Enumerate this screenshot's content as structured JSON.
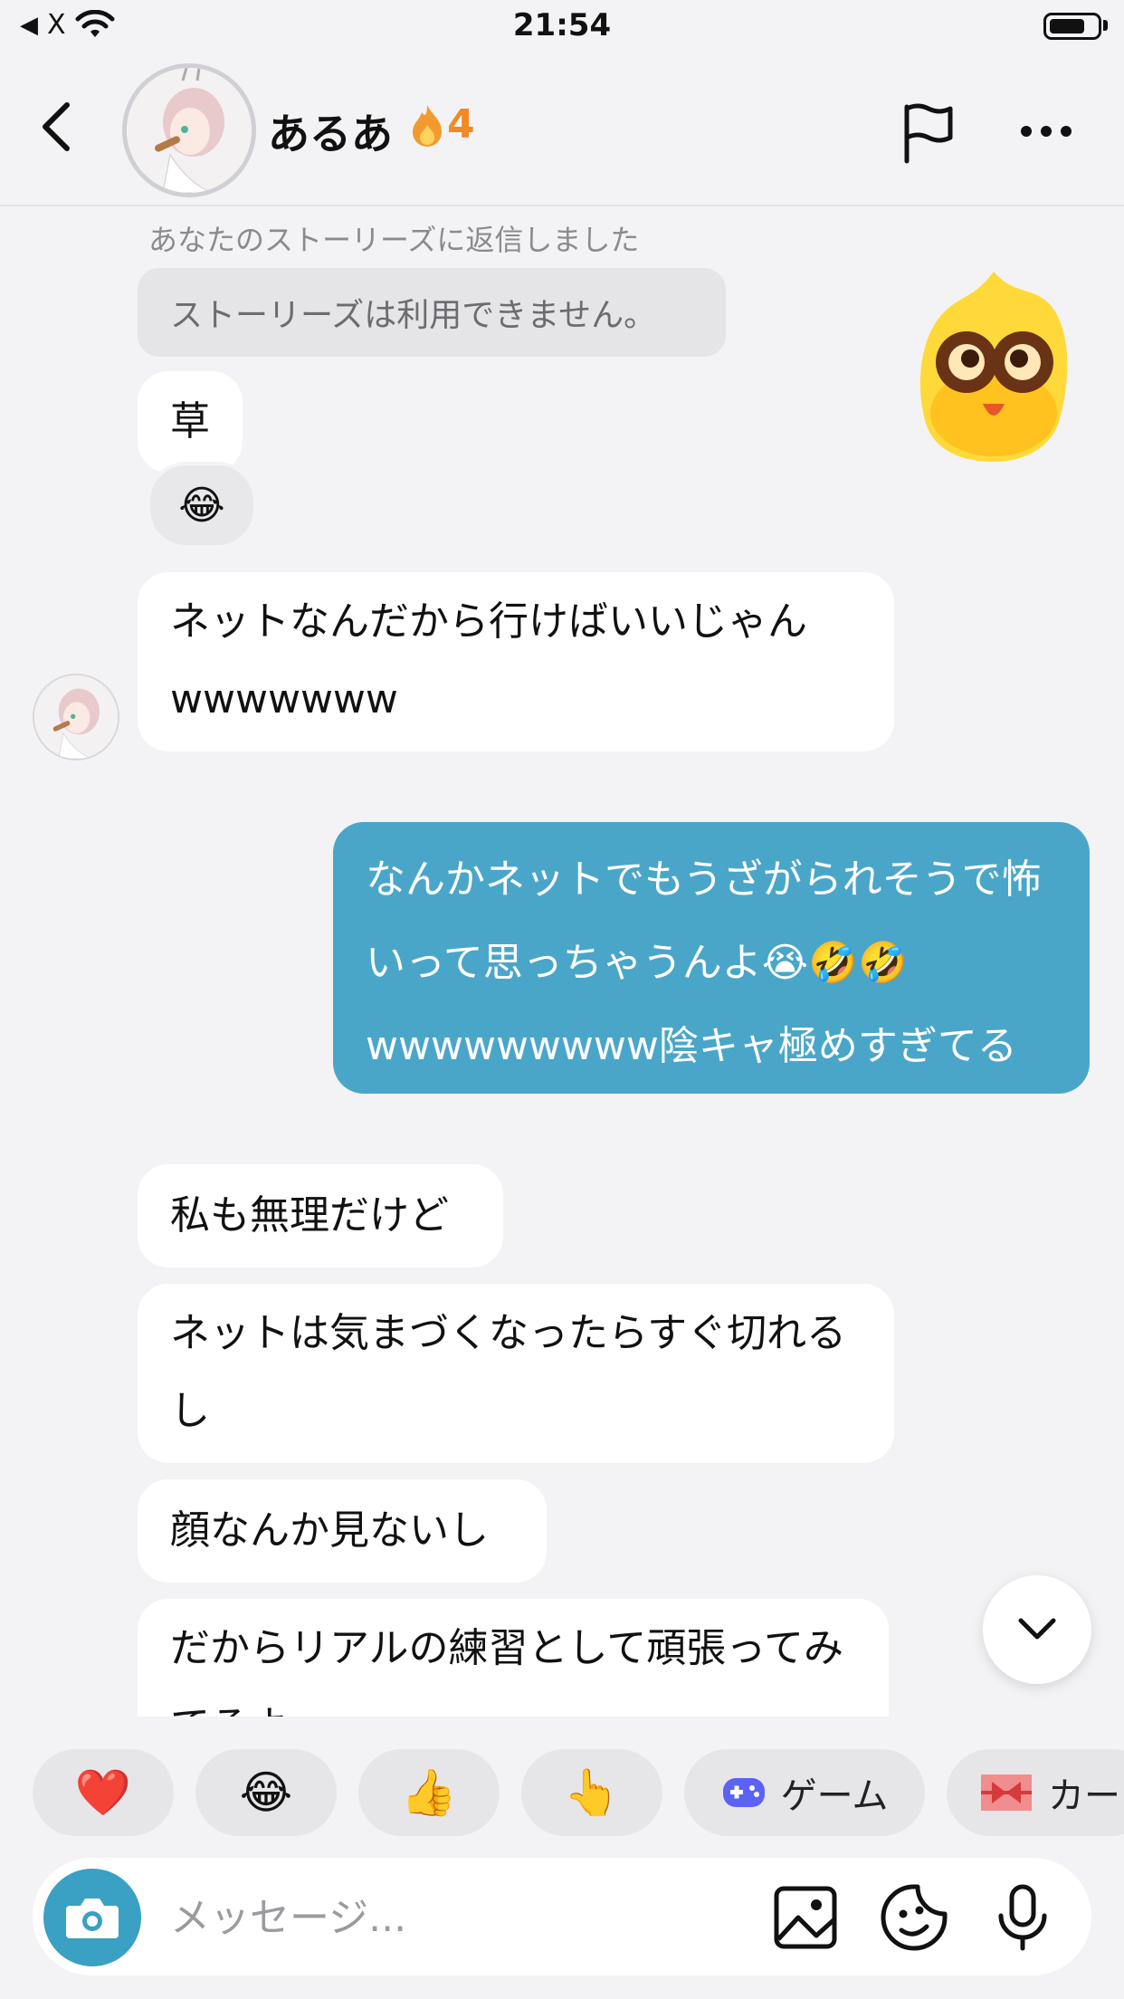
{
  "status_bar": {
    "back_app": "X",
    "time": "21:54"
  },
  "header": {
    "title": "あるあ",
    "streak_icon": "fire",
    "streak_count": "4"
  },
  "chat": {
    "reply_note": "あなたのストーリーズに返信しました",
    "story_unavailable": "ストーリーズは利用できません。",
    "messages": [
      {
        "id": "m1",
        "side": "in",
        "text": "草"
      },
      {
        "id": "m2",
        "side": "in",
        "text": "ネットなんだから行けばいいじゃんwwwwwww"
      },
      {
        "id": "m3",
        "side": "out",
        "text": "なんかネットでもうざがられそうで怖いって思っちゃうんよ😭🤣🤣wwwwwwwww陰キャ極めすぎてる"
      },
      {
        "id": "m4",
        "side": "in",
        "text": "私も無理だけど"
      },
      {
        "id": "m5",
        "side": "in",
        "text": "ネットは気まづくなったらすぐ切れるし"
      },
      {
        "id": "m6",
        "side": "in",
        "text": "顔なんか見ないし"
      },
      {
        "id": "m7",
        "side": "in",
        "text": "だからリアルの練習として頑張ってみてるよ"
      }
    ],
    "reaction_on_m1": "😂",
    "sticker": "yellow-flame-mascot-sticker"
  },
  "quick_reactions": [
    {
      "emoji": "❤️",
      "label": ""
    },
    {
      "emoji": "😂",
      "label": ""
    },
    {
      "emoji": "👍",
      "label": ""
    },
    {
      "emoji": "👆",
      "label": ""
    },
    {
      "emoji": "🎮",
      "label": "ゲーム"
    },
    {
      "emoji": "🎀",
      "label": "カー"
    }
  ],
  "composer": {
    "placeholder": "メッセージ..."
  },
  "colors": {
    "outgoing_bubble": "#4aa6c9",
    "camera_button": "#3aa0c4",
    "streak": "#f08a24"
  }
}
